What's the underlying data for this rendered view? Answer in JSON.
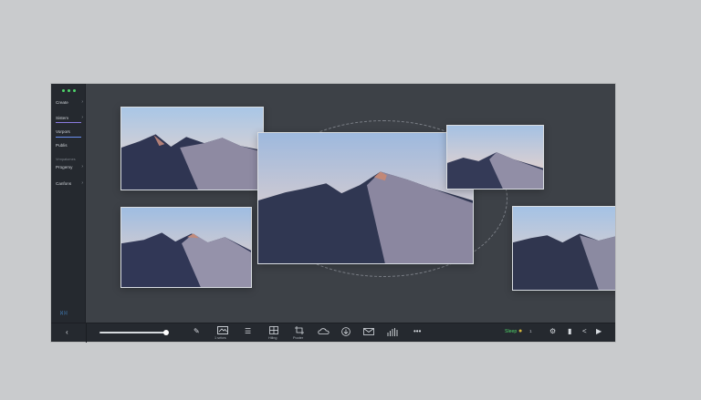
{
  "sidebar": {
    "items": [
      {
        "label": "Create"
      },
      {
        "label": "Sistem"
      },
      {
        "label": "Vorpors"
      },
      {
        "label": "Publis"
      },
      {
        "label": "Progemy"
      },
      {
        "label": "Canfons"
      }
    ],
    "section_label": "Vrrnpatomes",
    "footer": "ᛞ ᛞ"
  },
  "toolbar": {
    "labels": {
      "frame": "1 srfors",
      "stack": "Hiling",
      "crop": "Pooter"
    },
    "status": "Sleep",
    "count": "1",
    "zoom_level": 1.0
  },
  "icons": {
    "back": "chevron-left-icon",
    "brush": "brush-icon",
    "frame": "image-frame-icon",
    "text": "text-lines-icon",
    "stack": "stack-icon",
    "crop": "crop-icon",
    "cloud": "cloud-icon",
    "download": "download-icon",
    "mail": "mail-icon",
    "audio": "audio-bars-icon",
    "more": "more-icon",
    "drop": "drop-icon",
    "settings": "gear-icon",
    "layout": "layout-icon",
    "share": "share-icon",
    "play": "play-icon"
  },
  "colors": {
    "accent_green": "#4fd46a",
    "accent_blue": "#6b8ff0",
    "accent_purple": "#8a7be0"
  }
}
